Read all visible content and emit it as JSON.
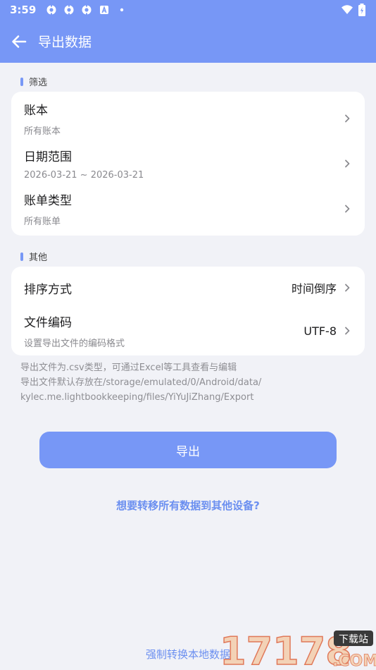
{
  "status_bar": {
    "time": "3:59",
    "notification_icons": [
      "settings-gear-icon",
      "settings-gear-icon",
      "settings-gear-icon",
      "font-a-icon",
      "dot-icon"
    ],
    "right_icons": [
      "wifi-icon",
      "battery-icon"
    ]
  },
  "app_bar": {
    "back_icon": "arrow-left-icon",
    "title": "导出数据"
  },
  "filter_section": {
    "label": "筛选",
    "items": [
      {
        "label": "账本",
        "sub": "所有账本"
      },
      {
        "label": "日期范围",
        "sub": "2026-03-21 ~ 2026-03-21"
      },
      {
        "label": "账单类型",
        "sub": "所有账单"
      }
    ]
  },
  "other_section": {
    "label": "其他",
    "sort": {
      "label": "排序方式",
      "value": "时间倒序"
    },
    "encoding": {
      "label": "文件编码",
      "sub": "设置导出文件的编码格式",
      "value": "UTF-8"
    }
  },
  "notes": [
    "导出文件为.csv类型，可通过Excel等工具查看与编辑",
    "导出文件默认存放在/storage/emulated/0/Android/data/",
    "kylec.me.lightbookkeeping/files/YiYuJiZhang/Export"
  ],
  "export_button": {
    "label": "导出"
  },
  "transfer_link": {
    "label": "想要转移所有数据到其他设备?"
  },
  "force_convert_link": {
    "label": "强制转换本地数据"
  },
  "watermark": {
    "number": "17178",
    "badge": "下载站",
    "domain": ".COM"
  },
  "colors": {
    "accent": "#7797f6",
    "link": "#6b8ff0",
    "background": "#f1f2f7"
  }
}
